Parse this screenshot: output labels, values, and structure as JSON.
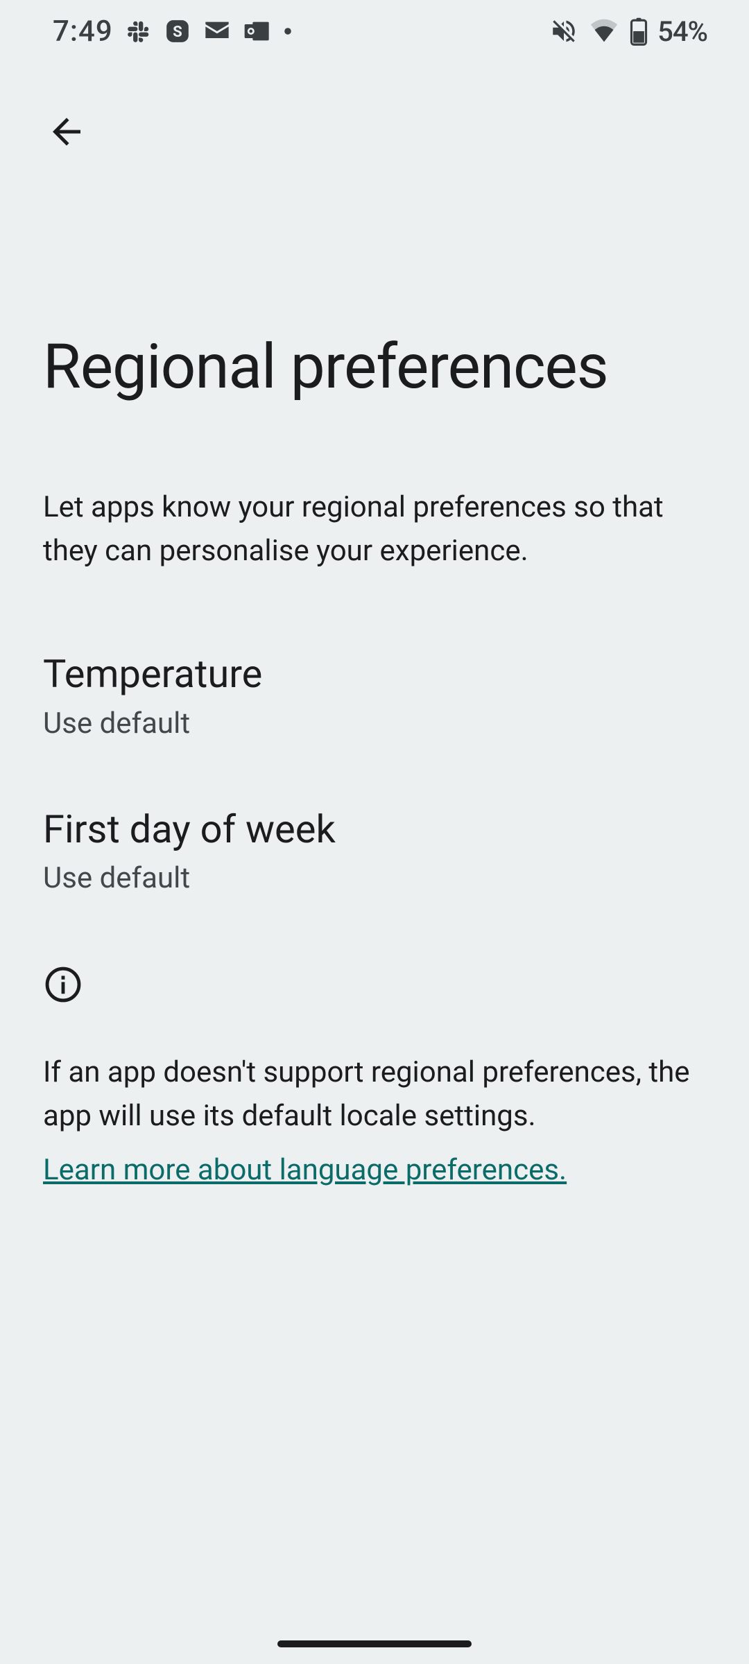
{
  "status": {
    "time": "7:49",
    "battery": "54%"
  },
  "page": {
    "title": "Regional preferences",
    "subtitle": "Let apps know your regional preferences so that they can personalise your experience."
  },
  "settings": {
    "temperature": {
      "title": "Temperature",
      "value": "Use default"
    },
    "firstDayOfWeek": {
      "title": "First day of week",
      "value": "Use default"
    }
  },
  "info": {
    "text": "If an app doesn't support regional preferences, the app will use its default locale settings.",
    "learnMore": "Learn more about language preferences."
  }
}
